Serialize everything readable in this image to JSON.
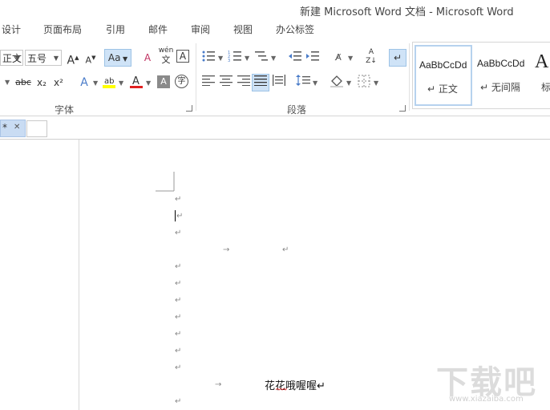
{
  "window": {
    "title": "新建 Microsoft Word 文档 - Microsoft Word"
  },
  "tabs": [
    "设计",
    "页面布局",
    "引用",
    "邮件",
    "审阅",
    "视图",
    "办公标签"
  ],
  "font": {
    "name_value": "正文",
    "size_value": "五号",
    "style_button": "Aa",
    "wen_label": "wén",
    "wen_char": "文",
    "strike_label": "abc",
    "sub_label": "x₂",
    "sup_label": "x²",
    "group_label": "字体"
  },
  "paragraph": {
    "group_label": "段落"
  },
  "styles": [
    {
      "sample": "AaBbCcDd",
      "name": "↵ 正文"
    },
    {
      "sample": "AaBbCcDd",
      "name": "↵ 无间隔"
    },
    {
      "sample": "A",
      "name": "标"
    }
  ],
  "doctabs": {
    "active_marker": "*",
    "close_symbol": "✕"
  },
  "document": {
    "text_line": "花花哦喔喔↵",
    "paragraph_mark": "↵",
    "tab_arrow": "→"
  },
  "watermark": {
    "text": "下载吧",
    "url": "www.xiazaiba.com"
  },
  "colors": {
    "highlight": "#ffff00",
    "font_color": "#e02020",
    "selection": "#cfe3f7"
  }
}
